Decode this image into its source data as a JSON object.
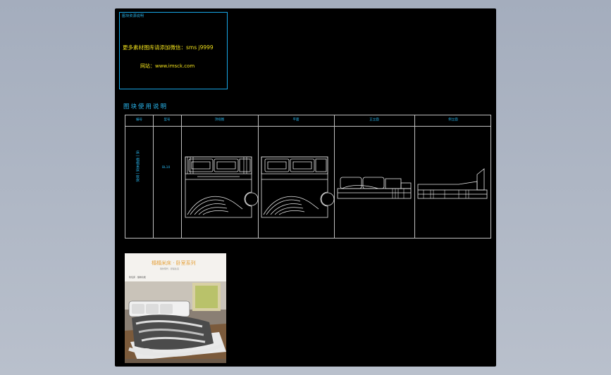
{
  "info_box": {
    "header": "图块资源说明",
    "line1": "更多素材图库请添加微信：sms j9999",
    "line2": "网站：www.imsck.com"
  },
  "section_title": "图块使用说明",
  "table": {
    "headers": [
      "编号",
      "型号",
      "顶视图",
      "平面",
      "正立面",
      "侧立面"
    ],
    "item_name": "床 | 榻榻米床 | 软床",
    "item_model": "BL10"
  },
  "photo": {
    "brand": "榻榻米床 · 卧室系列",
    "tagline": "简约现代 · 舒适生活",
    "label": "软包床 · 储物功能"
  },
  "colors": {
    "canvas": "#000000",
    "accent_blue": "#19a8e8",
    "accent_yellow": "#f2e21c",
    "line_grey": "#bfbfbf",
    "background": "#a4adbd"
  }
}
